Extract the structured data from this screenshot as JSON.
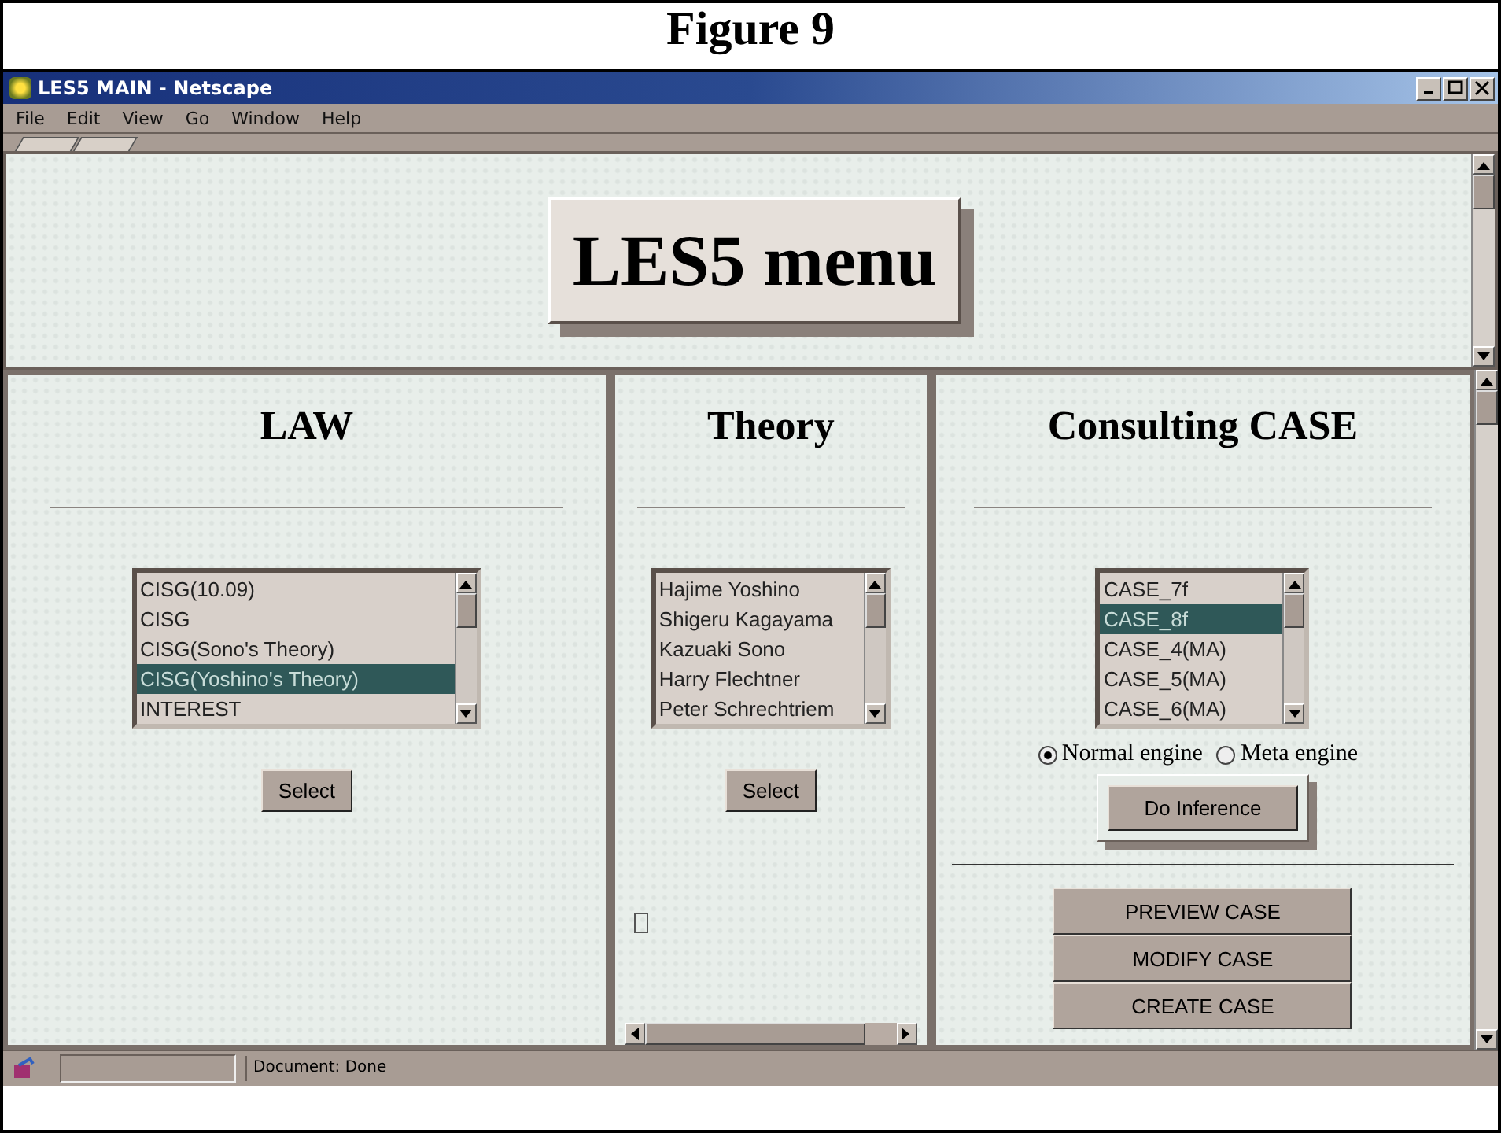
{
  "figure_caption": "Figure 9",
  "window": {
    "title": "LES5 MAIN - Netscape"
  },
  "menu": [
    "File",
    "Edit",
    "View",
    "Go",
    "Window",
    "Help"
  ],
  "banner": {
    "title": "LES5 menu"
  },
  "law": {
    "heading": "LAW",
    "items": [
      {
        "label": "CISG(10.09)",
        "selected": false
      },
      {
        "label": "CISG",
        "selected": false
      },
      {
        "label": "CISG(Sono's Theory)",
        "selected": false
      },
      {
        "label": "CISG(Yoshino's Theory)",
        "selected": true
      },
      {
        "label": "INTEREST",
        "selected": false
      }
    ],
    "button": "Select"
  },
  "theory": {
    "heading": "Theory",
    "items": [
      {
        "label": "Hajime Yoshino",
        "selected": false
      },
      {
        "label": "Shigeru Kagayama",
        "selected": false
      },
      {
        "label": "Kazuaki Sono",
        "selected": false
      },
      {
        "label": "Harry Flechtner",
        "selected": false
      },
      {
        "label": "Peter Schrechtriem",
        "selected": false
      }
    ],
    "button": "Select"
  },
  "consulting": {
    "heading": "Consulting CASE",
    "items": [
      {
        "label": "CASE_7f",
        "selected": false
      },
      {
        "label": "CASE_8f",
        "selected": true
      },
      {
        "label": "CASE_4(MA)",
        "selected": false
      },
      {
        "label": "CASE_5(MA)",
        "selected": false
      },
      {
        "label": "CASE_6(MA)",
        "selected": false
      }
    ],
    "engines": [
      {
        "label": "Normal engine",
        "selected": true
      },
      {
        "label": "Meta engine",
        "selected": false
      }
    ],
    "infer_button": "Do Inference",
    "actions": [
      "PREVIEW CASE",
      "MODIFY CASE",
      "CREATE CASE"
    ]
  },
  "status_bar": {
    "text": "Document: Done"
  }
}
